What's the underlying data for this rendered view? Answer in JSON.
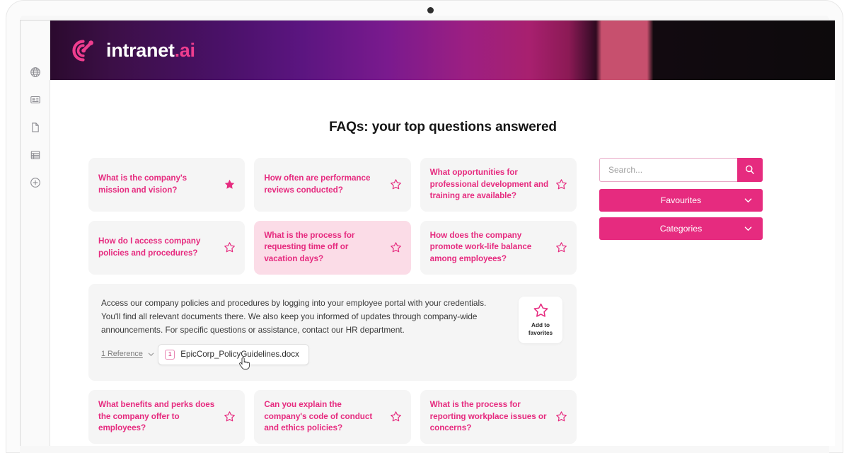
{
  "brand": {
    "logo_text": "intranet",
    "logo_suffix": ".ai",
    "logo_icon": "spiral-target-icon",
    "accent_color": "#e62b7f",
    "logo_accent": "#ef3d8e"
  },
  "left_rail": {
    "items": [
      {
        "icon": "globe-icon",
        "name": "sidebar-item-globe"
      },
      {
        "icon": "news-card-icon",
        "name": "sidebar-item-news"
      },
      {
        "icon": "document-icon",
        "name": "sidebar-item-document"
      },
      {
        "icon": "list-database-icon",
        "name": "sidebar-item-list"
      },
      {
        "icon": "plus-circle-icon",
        "name": "sidebar-item-add"
      }
    ]
  },
  "page": {
    "title": "FAQs: your top questions answered"
  },
  "faq_rows": [
    [
      {
        "question": "What is the company's mission and vision?",
        "favorited": true,
        "selected": false
      },
      {
        "question": "How often are performance reviews conducted?",
        "favorited": false,
        "selected": false
      },
      {
        "question": "What opportunities for professional development and training are available?",
        "favorited": false,
        "selected": false
      }
    ],
    [
      {
        "question": "How do I access company policies and procedures?",
        "favorited": false,
        "selected": false
      },
      {
        "question": "What is the process for requesting time off or vacation days?",
        "favorited": false,
        "selected": true
      },
      {
        "question": "How does the company promote work-life balance among employees?",
        "favorited": false,
        "selected": false
      }
    ]
  ],
  "faq_rows_bottom": [
    [
      {
        "question": "What benefits and perks does the company offer to employees?",
        "favorited": false,
        "selected": false
      },
      {
        "question": "Can you explain the company's code of conduct and ethics policies?",
        "favorited": false,
        "selected": false
      },
      {
        "question": "What is the process for reporting workplace issues or concerns?",
        "favorited": false,
        "selected": false
      }
    ]
  ],
  "answer_panel": {
    "text": "Access our company policies and procedures by logging into your employee portal with your credentials. You'll find all relevant documents there. We also keep you informed of updates through company-wide announcements. For specific questions or assistance, contact our HR department.",
    "reference_label": "1 Reference",
    "reference_chevron": "chevron-down-icon",
    "file": {
      "badge": "1",
      "name": "EpicCorp_PolicyGuidelines.docx"
    },
    "favorite_button": {
      "icon": "star-outline-icon",
      "line1": "Add to",
      "line2": "favorites"
    }
  },
  "sidebar": {
    "search": {
      "placeholder": "Search...",
      "value": "",
      "button_icon": "search-icon"
    },
    "dropdowns": [
      {
        "label": "Favourites",
        "icon": "chevron-down-icon"
      },
      {
        "label": "Categories",
        "icon": "chevron-down-icon"
      }
    ]
  },
  "cursor": {
    "icon": "pointer-hand-icon"
  }
}
